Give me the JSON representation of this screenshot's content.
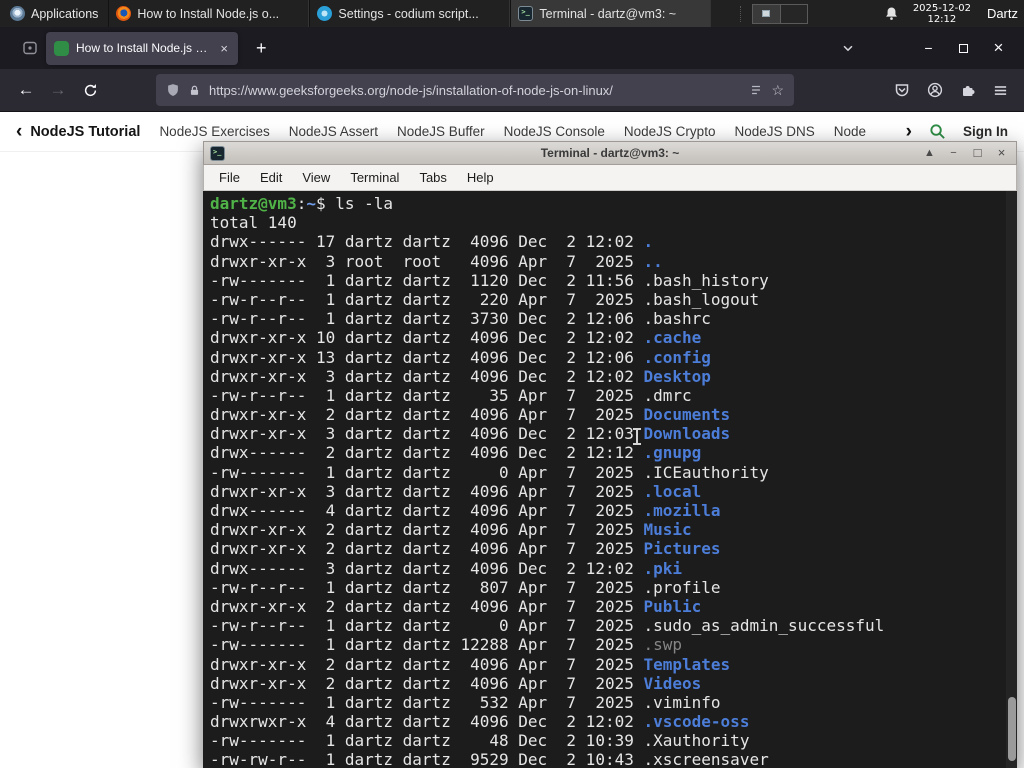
{
  "colors": {
    "gfg_green": "#2f8d46",
    "terminal_dir_blue": "#4c7dd8",
    "terminal_prompt_green": "#50b348",
    "firefox_tabbar": "#1c1b22",
    "firefox_toolbar": "#2b2a33"
  },
  "panel": {
    "applications_label": "Applications",
    "tasks": [
      {
        "title": "How to Install Node.js o...",
        "icon": "firefox"
      },
      {
        "title": "Settings - codium script...",
        "icon": "codium"
      },
      {
        "title": "Terminal - dartz@vm3: ~",
        "icon": "terminal"
      }
    ],
    "clock": {
      "date": "2025-12-02",
      "time": "12:12"
    },
    "user_label": "Dartz"
  },
  "browser": {
    "tab_title": "How to Install Node.js on...",
    "new_tab_label": "+",
    "url": "https://www.geeksforgeeks.org/node-js/installation-of-node-js-on-linux/"
  },
  "site_nav": {
    "active_item": "NodeJS Tutorial",
    "links": [
      "NodeJS Exercises",
      "NodeJS Assert",
      "NodeJS Buffer",
      "NodeJS Console",
      "NodeJS Crypto",
      "NodeJS DNS",
      "Node"
    ],
    "sign_in_label": "Sign In"
  },
  "terminal": {
    "window_title": "Terminal - dartz@vm3: ~",
    "menu_items": [
      "File",
      "Edit",
      "View",
      "Terminal",
      "Tabs",
      "Help"
    ],
    "prompt": {
      "user_host": "dartz@vm3",
      "separator": ":",
      "path": "~",
      "symbol": "$"
    },
    "command": "ls -la",
    "total_line": "total 140",
    "files": [
      {
        "meta": "drwx------ 17 dartz dartz  4096 Dec  2 12:02 ",
        "name": ".",
        "type": "dir"
      },
      {
        "meta": "drwxr-xr-x  3 root  root   4096 Apr  7  2025 ",
        "name": "..",
        "type": "dir"
      },
      {
        "meta": "-rw-------  1 dartz dartz  1120 Dec  2 11:56 ",
        "name": ".bash_history",
        "type": "file"
      },
      {
        "meta": "-rw-r--r--  1 dartz dartz   220 Apr  7  2025 ",
        "name": ".bash_logout",
        "type": "file"
      },
      {
        "meta": "-rw-r--r--  1 dartz dartz  3730 Dec  2 12:06 ",
        "name": ".bashrc",
        "type": "file"
      },
      {
        "meta": "drwxr-xr-x 10 dartz dartz  4096 Dec  2 12:02 ",
        "name": ".cache",
        "type": "dir"
      },
      {
        "meta": "drwxr-xr-x 13 dartz dartz  4096 Dec  2 12:06 ",
        "name": ".config",
        "type": "dir"
      },
      {
        "meta": "drwxr-xr-x  3 dartz dartz  4096 Dec  2 12:02 ",
        "name": "Desktop",
        "type": "dir"
      },
      {
        "meta": "-rw-r--r--  1 dartz dartz    35 Apr  7  2025 ",
        "name": ".dmrc",
        "type": "file"
      },
      {
        "meta": "drwxr-xr-x  2 dartz dartz  4096 Apr  7  2025 ",
        "name": "Documents",
        "type": "dir"
      },
      {
        "meta": "drwxr-xr-x  3 dartz dartz  4096 Dec  2 12:03 ",
        "name": "Downloads",
        "type": "dir"
      },
      {
        "meta": "drwx------  2 dartz dartz  4096 Dec  2 12:12 ",
        "name": ".gnupg",
        "type": "dir"
      },
      {
        "meta": "-rw-------  1 dartz dartz     0 Apr  7  2025 ",
        "name": ".ICEauthority",
        "type": "file"
      },
      {
        "meta": "drwxr-xr-x  3 dartz dartz  4096 Apr  7  2025 ",
        "name": ".local",
        "type": "dir"
      },
      {
        "meta": "drwx------  4 dartz dartz  4096 Apr  7  2025 ",
        "name": ".mozilla",
        "type": "dir"
      },
      {
        "meta": "drwxr-xr-x  2 dartz dartz  4096 Apr  7  2025 ",
        "name": "Music",
        "type": "dir"
      },
      {
        "meta": "drwxr-xr-x  2 dartz dartz  4096 Apr  7  2025 ",
        "name": "Pictures",
        "type": "dir"
      },
      {
        "meta": "drwx------  3 dartz dartz  4096 Dec  2 12:02 ",
        "name": ".pki",
        "type": "dir"
      },
      {
        "meta": "-rw-r--r--  1 dartz dartz   807 Apr  7  2025 ",
        "name": ".profile",
        "type": "file"
      },
      {
        "meta": "drwxr-xr-x  2 dartz dartz  4096 Apr  7  2025 ",
        "name": "Public",
        "type": "dir"
      },
      {
        "meta": "-rw-r--r--  1 dartz dartz     0 Apr  7  2025 ",
        "name": ".sudo_as_admin_successful",
        "type": "file"
      },
      {
        "meta": "-rw-------  1 dartz dartz 12288 Apr  7  2025 ",
        "name": ".swp",
        "type": "dim"
      },
      {
        "meta": "drwxr-xr-x  2 dartz dartz  4096 Apr  7  2025 ",
        "name": "Templates",
        "type": "dir"
      },
      {
        "meta": "drwxr-xr-x  2 dartz dartz  4096 Apr  7  2025 ",
        "name": "Videos",
        "type": "dir"
      },
      {
        "meta": "-rw-------  1 dartz dartz   532 Apr  7  2025 ",
        "name": ".viminfo",
        "type": "file"
      },
      {
        "meta": "drwxrwxr-x  4 dartz dartz  4096 Dec  2 12:02 ",
        "name": ".vscode-oss",
        "type": "dir"
      },
      {
        "meta": "-rw-------  1 dartz dartz    48 Dec  2 10:39 ",
        "name": ".Xauthority",
        "type": "file"
      },
      {
        "meta": "-rw-rw-r--  1 dartz dartz  9529 Dec  2 10:43 ",
        "name": ".xscreensaver",
        "type": "file"
      }
    ]
  }
}
